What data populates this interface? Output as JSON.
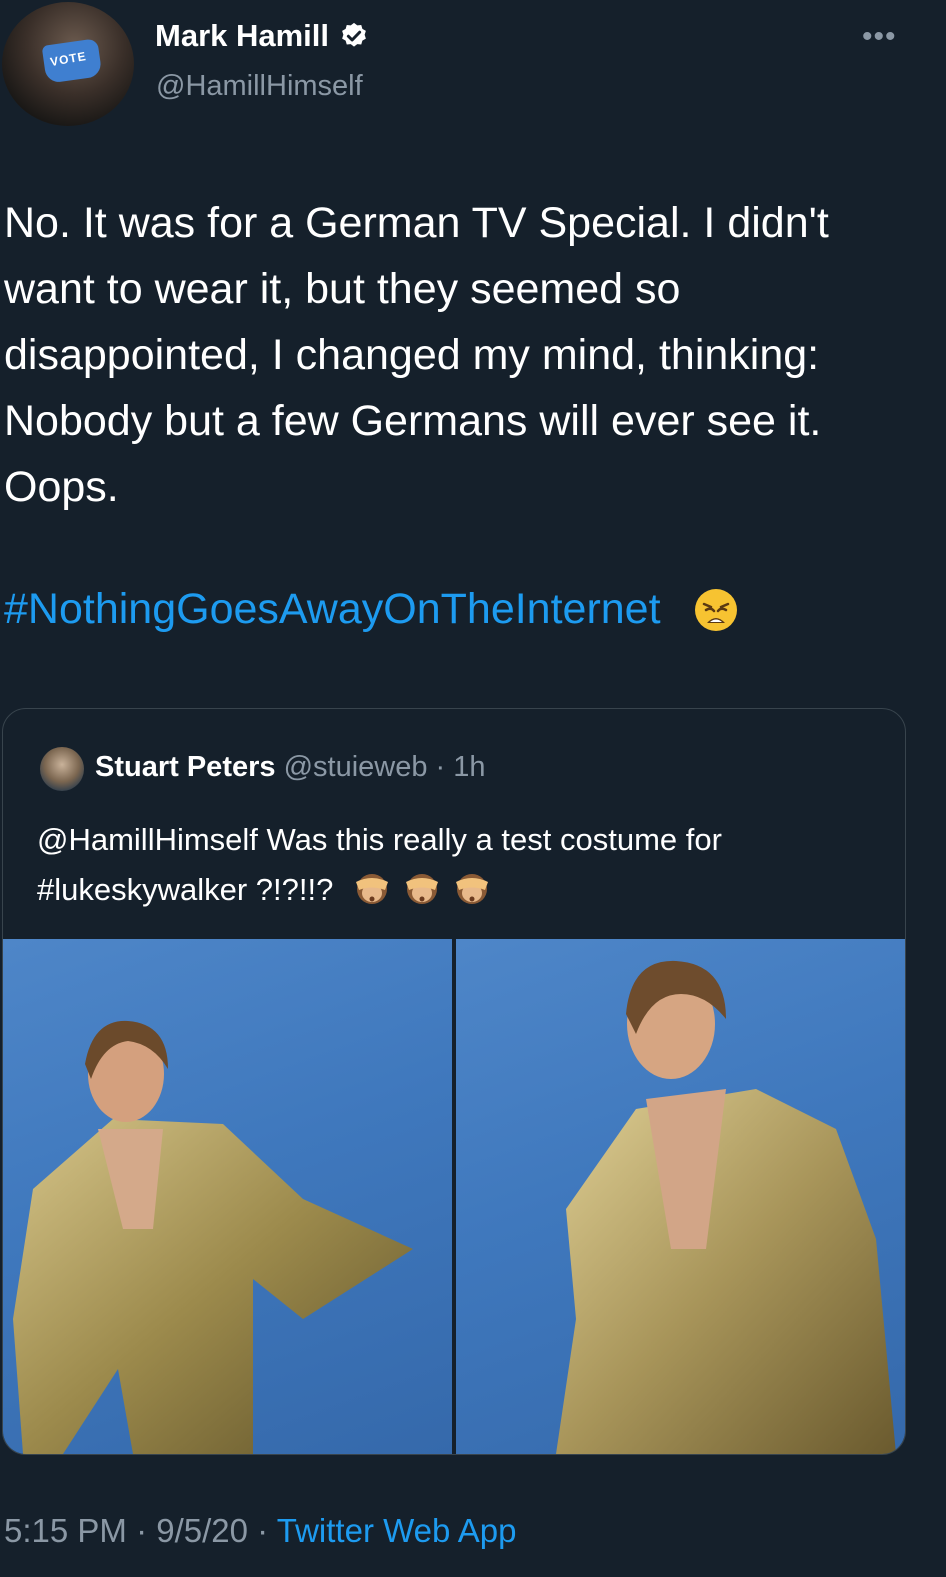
{
  "author": {
    "display_name": "Mark Hamill",
    "handle": "@HamillHimself",
    "avatar_mask_text": "VOTE"
  },
  "tweet": {
    "text": "No. It was for a German TV Special. I didn't want to wear it, but they seemed so disappointed, I changed my mind, thinking: Nobody but a few Germans will ever see it. Oops.",
    "hashtag": "#NothingGoesAwayOnTheInternet"
  },
  "quoted_tweet": {
    "display_name": "Stuart Peters",
    "handle": "@stuieweb",
    "separator": "·",
    "time": "1h",
    "text": "@HamillHimself Was this really a test costume for #lukeskywalker ?!?!!?"
  },
  "footer": {
    "time": "5:15 PM",
    "separator1": "·",
    "date": "9/5/20",
    "separator2": "·",
    "source": "Twitter Web App"
  },
  "icons": {
    "verified": "verified-badge-icon",
    "more": "more-options-icon",
    "weary_face": "weary-face-emoji",
    "see_no_evil": "see-no-evil-monkey-emoji"
  },
  "colors": {
    "background": "#15202b",
    "accent": "#1d9bf0",
    "secondary_text": "#8b98a5",
    "border": "#38444d"
  }
}
